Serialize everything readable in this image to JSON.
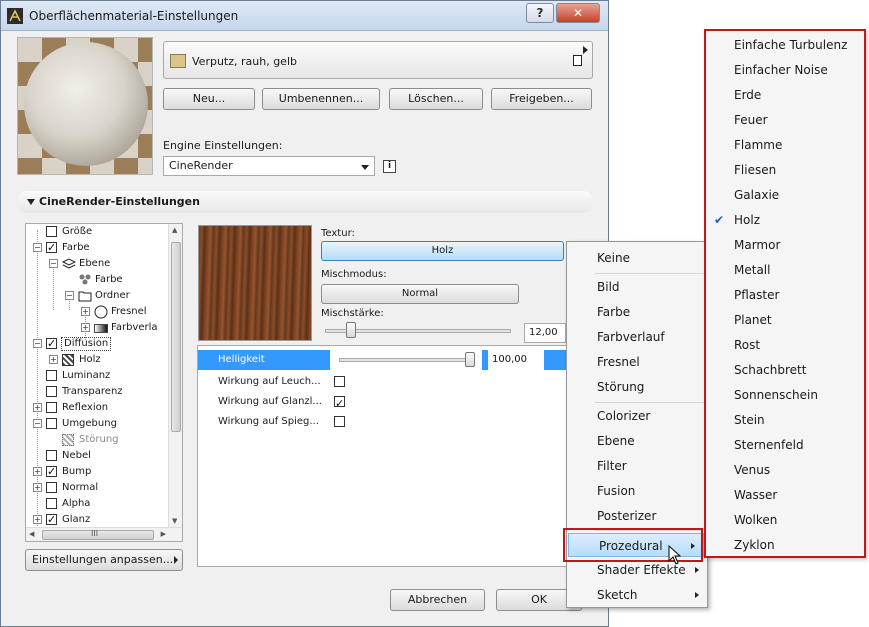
{
  "window": {
    "title": "Oberflächenmaterial-Einstellungen",
    "help_label": "?",
    "close_label": "✕"
  },
  "material": {
    "name": "Verputz, rauh, gelb",
    "swatch_color": "#dbc588"
  },
  "actions": {
    "new": "Neu...",
    "rename": "Umbenennen...",
    "delete": "Löschen...",
    "share": "Freigeben..."
  },
  "engine": {
    "label": "Engine Einstellungen:",
    "value": "CineRender"
  },
  "section": {
    "title": "CineRender-Einstellungen"
  },
  "tree": {
    "items": [
      {
        "label": "Größe",
        "checked": false
      },
      {
        "label": "Farbe",
        "checked": true
      },
      {
        "label": "Ebene"
      },
      {
        "label": "Farbe"
      },
      {
        "label": "Ordner"
      },
      {
        "label": "Fresnel"
      },
      {
        "label": "Farbverla"
      },
      {
        "label": "Diffusion",
        "checked": true
      },
      {
        "label": "Holz"
      },
      {
        "label": "Luminanz",
        "checked": false
      },
      {
        "label": "Transparenz",
        "checked": false
      },
      {
        "label": "Reflexion",
        "checked": false
      },
      {
        "label": "Umgebung",
        "checked": false
      },
      {
        "label": "Störung"
      },
      {
        "label": "Nebel",
        "checked": false
      },
      {
        "label": "Bump",
        "checked": true
      },
      {
        "label": "Normal",
        "checked": false
      },
      {
        "label": "Alpha",
        "checked": false
      },
      {
        "label": "Glanz",
        "checked": true
      }
    ],
    "hscroll_label": "III"
  },
  "customize_button": "Einstellungen anpassen...",
  "texture": {
    "label": "Textur:",
    "value": "Holz",
    "mix_label": "Mischmodus:",
    "mix_value": "Normal",
    "strength_label": "Mischstärke:",
    "strength_value": "12,00",
    "strength_fraction": 0.14
  },
  "properties": [
    {
      "label": "Helligkeit",
      "value": "100,00",
      "level": 1.0,
      "selected": true
    },
    {
      "label": "Wirkung auf Leuch...",
      "checked": false
    },
    {
      "label": "Wirkung auf Glanzl...",
      "checked": true
    },
    {
      "label": "Wirkung auf Spieg...",
      "checked": false
    }
  ],
  "footer": {
    "cancel": "Abbrechen",
    "ok": "OK"
  },
  "menu1": {
    "items": [
      "Keine",
      "Bild",
      "Farbe",
      "Farbverlauf",
      "Fresnel",
      "Störung",
      "Colorizer",
      "Ebene",
      "Filter",
      "Fusion",
      "Posterizer",
      "Prozedural",
      "Shader Effekte",
      "Sketch"
    ],
    "highlighted": "Prozedural"
  },
  "menu2": {
    "items": [
      "Einfache Turbulenz",
      "Einfacher Noise",
      "Erde",
      "Feuer",
      "Flamme",
      "Fliesen",
      "Galaxie",
      "Holz",
      "Marmor",
      "Metall",
      "Pflaster",
      "Planet",
      "Rost",
      "Schachbrett",
      "Sonnenschein",
      "Stein",
      "Sternenfeld",
      "Venus",
      "Wasser",
      "Wolken",
      "Zyklon"
    ],
    "checked": "Holz"
  },
  "colors": {
    "accent": "#3399ff",
    "highlight_box": "#c01818"
  }
}
